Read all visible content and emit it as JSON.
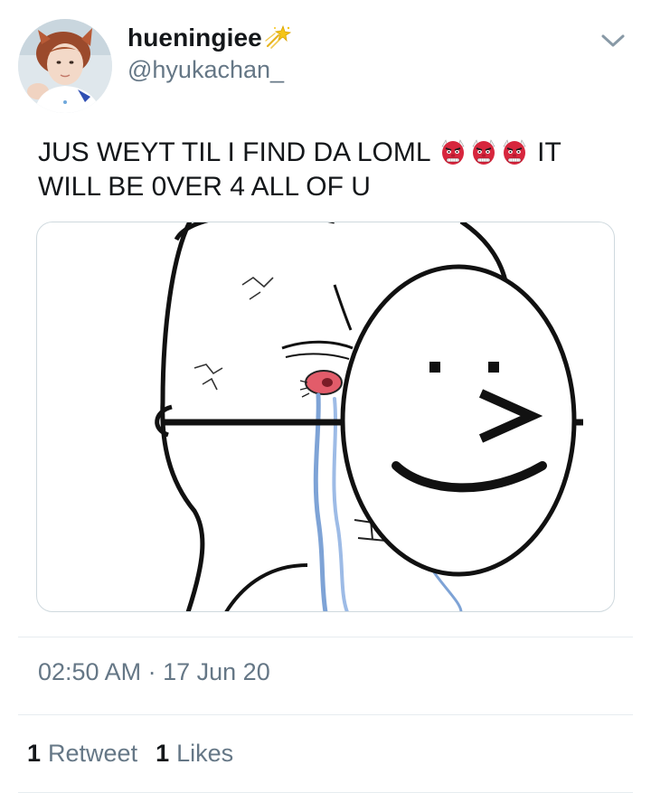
{
  "author": {
    "display_name": "hueningiee",
    "handle": "@hyukachan_",
    "avatar": "profile-photo",
    "name_decoration": "shooting-star-sparkle-icon"
  },
  "menu": {
    "icon": "chevron-down-icon"
  },
  "tweet": {
    "text_line_1_before": "JUS WEYT TIL I FIND DA LOML",
    "emojis": [
      "goblin-emoji",
      "goblin-emoji",
      "goblin-emoji"
    ],
    "text_line_1_after": "IT",
    "text_line_2": "WILL BE 0VER 4 ALL OF U",
    "media": "meme-crying-wojak-holding-smiling-mask"
  },
  "meta": {
    "time": "02:50 AM",
    "separator": "·",
    "date": "17 Jun 20"
  },
  "stats": {
    "retweet_count": "1",
    "retweet_label": "Retweet",
    "like_count": "1",
    "like_label": "Likes"
  },
  "colors": {
    "text_primary": "#14171a",
    "text_secondary": "#657786",
    "divider": "#e6ecf0",
    "goblin_red": "#d7263d"
  }
}
